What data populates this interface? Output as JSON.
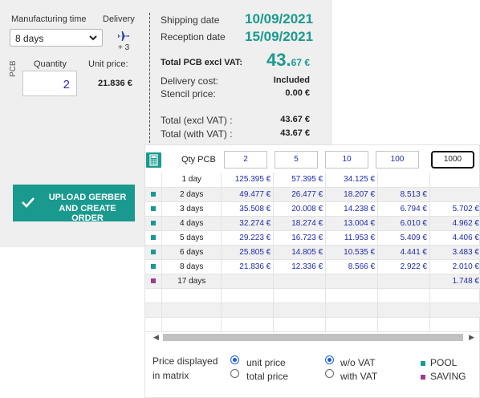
{
  "colors": {
    "teal": "#1a9a8f",
    "purple": "#9b3d8f",
    "price_blue": "#1f2bb0"
  },
  "order": {
    "manufacturing_time_label": "Manufacturing time",
    "delivery_label": "Delivery",
    "manufacturing_time_value": "8 days",
    "delivery_icon": "plane-icon",
    "delivery_extra_days": "+ 3",
    "quantity_label": "Quantity",
    "unit_price_label": "Unit price:",
    "pcb_label": "PCB",
    "quantity_value": "2",
    "unit_price_value": "21.836 €"
  },
  "summary": {
    "shipping_date_label": "Shipping date",
    "shipping_date": "10/09/2021",
    "reception_date_label": "Reception date",
    "reception_date": "15/09/2021",
    "total_pcb_label": "Total PCB excl VAT:",
    "total_pcb_int": "43.",
    "total_pcb_dec": "67 €",
    "delivery_cost_label": "Delivery cost:",
    "delivery_cost_value": "Included",
    "stencil_price_label": "Stencil price:",
    "stencil_price_value": "0.00 €",
    "total_excl_vat_label": "Total (excl VAT) :",
    "total_excl_vat_value": "43.67 €",
    "total_with_vat_label": "Total (with VAT) :",
    "total_with_vat_value": "43.67 €"
  },
  "upload_button": {
    "line1": "UPLOAD GERBER",
    "line2": "AND CREATE ORDER"
  },
  "matrix": {
    "calculator_icon": "calculator-icon",
    "qty_label": "Qty PCB",
    "quantities": [
      "2",
      "5",
      "10",
      "100",
      "1000"
    ],
    "selected_quantity": "1000",
    "rows": [
      {
        "days": "1 day",
        "type": "",
        "prices": [
          "125.395 €",
          "57.395 €",
          "34.125 €",
          "",
          ""
        ]
      },
      {
        "days": "2 days",
        "type": "pool",
        "prices": [
          "49.477 €",
          "26.477 €",
          "18.207 €",
          "8.513 €",
          ""
        ]
      },
      {
        "days": "3 days",
        "type": "pool",
        "prices": [
          "35.508 €",
          "20.008 €",
          "14.238 €",
          "6.794 €",
          "5.702 €"
        ]
      },
      {
        "days": "4 days",
        "type": "pool",
        "prices": [
          "32.274 €",
          "18.274 €",
          "13.004 €",
          "6.010 €",
          "4.962 €"
        ]
      },
      {
        "days": "5 days",
        "type": "pool",
        "prices": [
          "29.223 €",
          "16.723 €",
          "11.953 €",
          "5.409 €",
          "4.406 €"
        ]
      },
      {
        "days": "6 days",
        "type": "pool",
        "prices": [
          "25.805 €",
          "14.805 €",
          "10.535 €",
          "4.441 €",
          "3.483 €"
        ]
      },
      {
        "days": "8 days",
        "type": "pool",
        "prices": [
          "21.836 €",
          "12.336 €",
          "8.566 €",
          "2.922 €",
          "2.010 €"
        ]
      },
      {
        "days": "17 days",
        "type": "saving",
        "prices": [
          "",
          "",
          "",
          "",
          "1.748 €"
        ]
      },
      {
        "days": "",
        "type": "",
        "prices": [
          "",
          "",
          "",
          "",
          ""
        ]
      },
      {
        "days": "",
        "type": "",
        "prices": [
          "",
          "",
          "",
          "",
          ""
        ]
      },
      {
        "days": "",
        "type": "",
        "prices": [
          "",
          "",
          "",
          "",
          ""
        ]
      }
    ],
    "price_displayed_label_1": "Price displayed",
    "price_displayed_label_2": "in matrix",
    "unit_price_option": "unit price",
    "total_price_option": "total price",
    "wo_vat_option": "w/o VAT",
    "with_vat_option": "with VAT",
    "legend_pool": "POOL",
    "legend_saving": "SAVING"
  }
}
